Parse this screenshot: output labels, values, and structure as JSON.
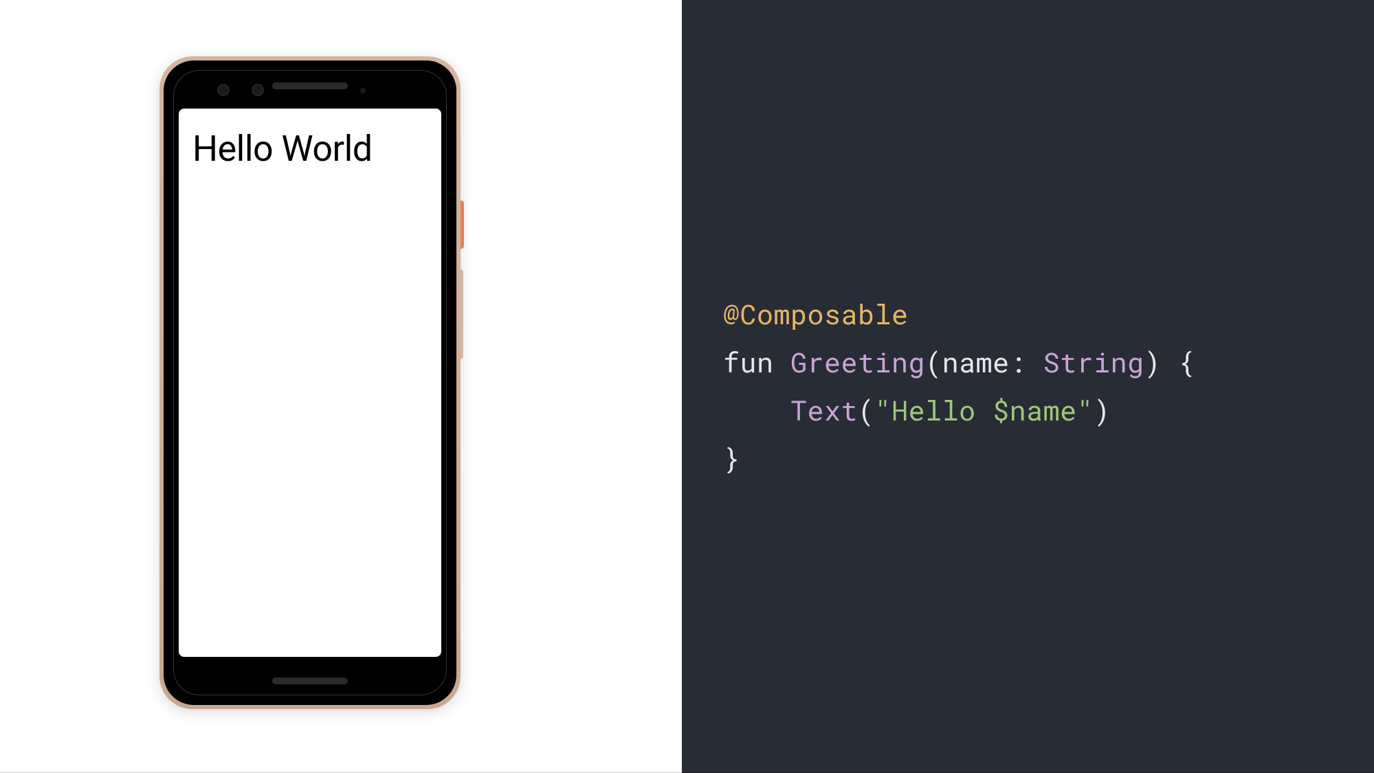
{
  "phone": {
    "screen_text": "Hello World"
  },
  "code": {
    "annotation": "@Composable",
    "keyword_fun": "fun",
    "function_name": "Greeting",
    "paren_open": "(",
    "param_name": "name",
    "colon": ": ",
    "param_type": "String",
    "paren_close": ")",
    "brace_open": " {",
    "indent": "    ",
    "call_name": "Text",
    "call_open": "(",
    "string_open": "\"",
    "string_part1": "Hello ",
    "interp": "$name",
    "string_close": "\"",
    "call_close": ")",
    "brace_close": "}"
  }
}
